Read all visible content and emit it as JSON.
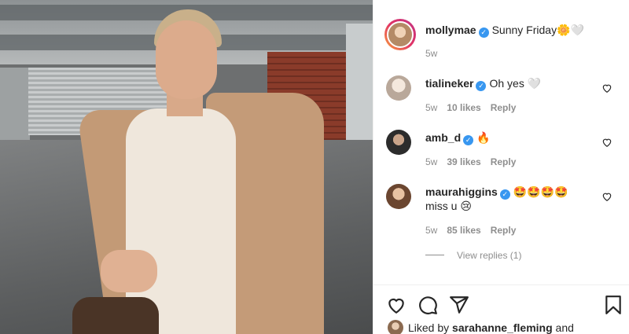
{
  "post": {
    "author": "mollymae",
    "caption": "Sunny Friday",
    "caption_emoji": "🌼🤍",
    "time": "5w"
  },
  "comments": [
    {
      "user": "tialineker",
      "verified": true,
      "text": "Oh yes",
      "emoji": "🤍",
      "time": "5w",
      "likes": "10 likes",
      "reply": "Reply"
    },
    {
      "user": "amb_d",
      "verified": true,
      "text": "",
      "emoji": "🔥",
      "time": "5w",
      "likes": "39 likes",
      "reply": "Reply"
    },
    {
      "user": "maurahiggins",
      "verified": true,
      "text": "",
      "emoji": "🤩🤩🤩🤩",
      "line2": "miss u",
      "line2_emoji": "😢",
      "time": "5w",
      "likes": "85 likes",
      "reply": "Reply"
    }
  ],
  "view_replies": "View replies (1)",
  "liked_by": {
    "prefix": "Liked by",
    "user": "sarahanne_fleming",
    "suffix": "and"
  },
  "icons": [
    "heart-icon",
    "comment-icon",
    "share-icon",
    "bookmark-icon",
    "verified-icon",
    "comment-heart-icon"
  ],
  "colors": {
    "verified": "#3897f0",
    "meta": "#8e8e8e",
    "text": "#262626"
  }
}
